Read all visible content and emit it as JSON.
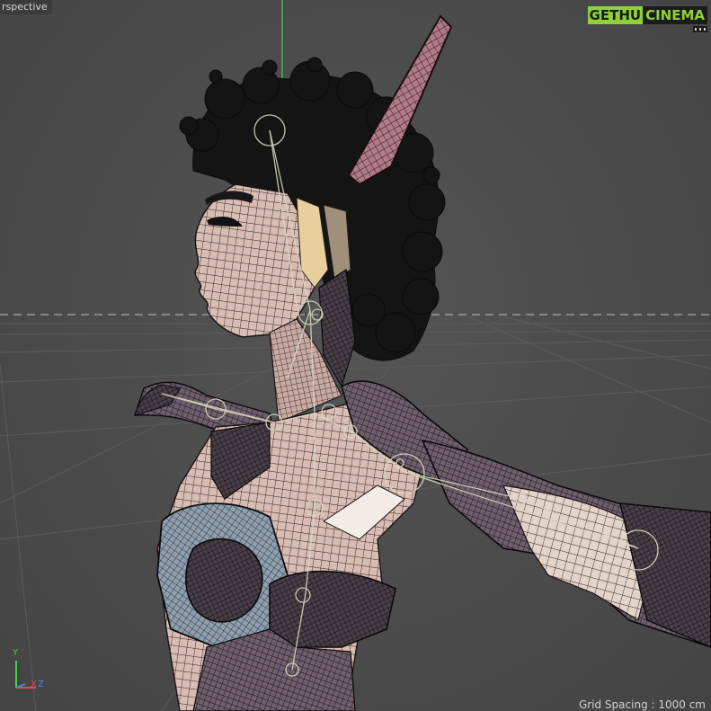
{
  "viewport": {
    "label": "rspective",
    "grid_spacing_text": "Grid Spacing : 1000 cm"
  },
  "watermark": {
    "part1": "GETHU",
    "part2": "CINEMA"
  },
  "axis_gizmo": {
    "y_label": "Y",
    "x_label": "X",
    "z_label": "Z"
  },
  "colors": {
    "background": "#4a4a4a",
    "grid_line": "#5b5b5b",
    "horizon_dash": "#9a9a9a",
    "wire": "#1a1a1a",
    "skin": "#e2c8bd",
    "armor": "#6e5a68",
    "bone": "#cfcfa8",
    "y_axis": "#3fd14f",
    "x_axis": "#e04a4a",
    "z_axis": "#4a8ae0",
    "logo_green": "#8fd13a"
  }
}
